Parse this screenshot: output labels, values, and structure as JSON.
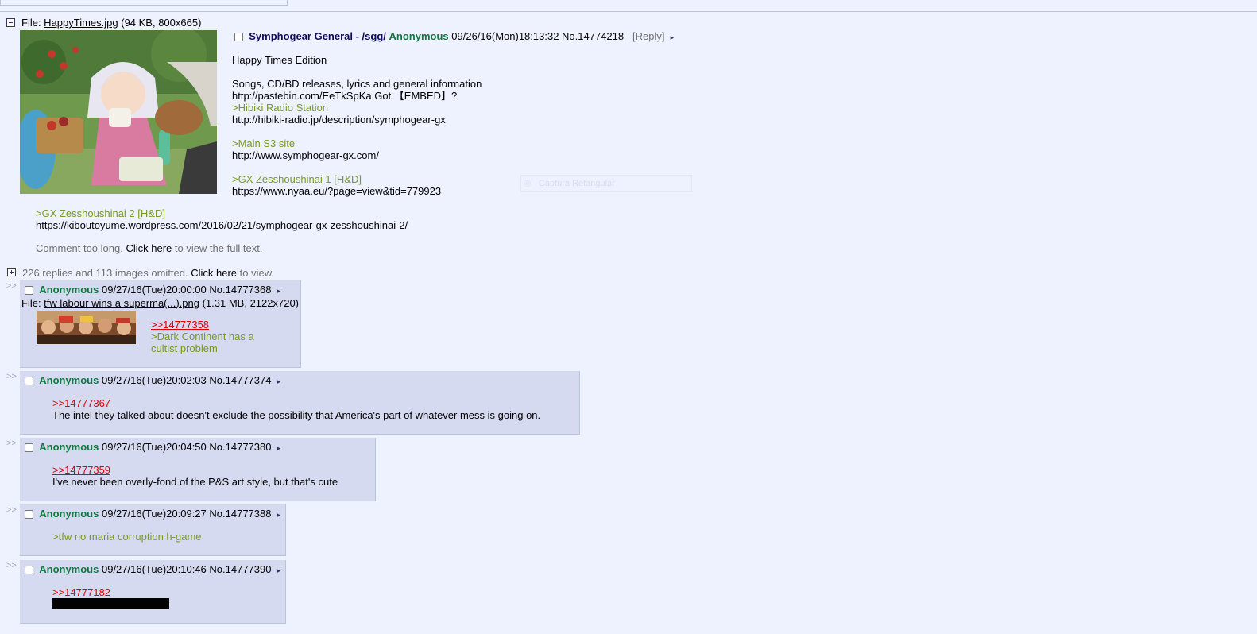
{
  "op": {
    "file_prefix": "File: ",
    "file_name": "HappyTimes.jpg",
    "file_meta": " (94 KB, 800x665)",
    "subject": "Symphogear General - /sgg/",
    "name": "Anonymous",
    "datetime": "09/26/16(Mon)18:13:32",
    "post_no": "No.14774218",
    "reply_link": "[Reply]",
    "arrow": "▸",
    "body": [
      {
        "text": "Happy Times Edition",
        "kind": "text"
      },
      {
        "text": "",
        "kind": "blank"
      },
      {
        "text": "Songs, CD/BD releases, lyrics and general information",
        "kind": "text"
      },
      {
        "text": "http://pastebin.com/EeTkSpKa Got 【EMBED】?",
        "kind": "text"
      },
      {
        "text": ">Hibiki Radio Station",
        "kind": "quote"
      },
      {
        "text": "http://hibiki-radio.jp/description/symphogear-gx",
        "kind": "text"
      },
      {
        "text": "",
        "kind": "blank"
      },
      {
        "text": ">Main S3 site",
        "kind": "quote"
      },
      {
        "text": "http://www.symphogear-gx.com/",
        "kind": "text"
      },
      {
        "text": "",
        "kind": "blank"
      },
      {
        "text": ">GX Zesshoushinai 1 [H&D]",
        "kind": "quote"
      },
      {
        "text": "https://www.nyaa.eu/?page=view&tid=779923",
        "kind": "text"
      }
    ],
    "body_below": [
      {
        "text": ">GX Zesshoushinai 2 [H&D]",
        "kind": "quote"
      },
      {
        "text": "https://kiboutoyume.wordpress.com/2016/02/21/symphogear-gx-zesshoushinai-2/",
        "kind": "text"
      }
    ],
    "too_long_prefix": "Comment too long. ",
    "too_long_click": "Click here",
    "too_long_suffix": " to view the full text."
  },
  "omitted": {
    "prefix": "226 replies and 113 images omitted. ",
    "click": "Click here",
    "suffix": " to view."
  },
  "overlay_label": "Captura Retangular",
  "side_marker": ">>",
  "replies": [
    {
      "name": "Anonymous",
      "datetime": "09/27/16(Tue)20:00:00",
      "post_no": "No.14777368",
      "file_prefix": "File: ",
      "file_name": "tfw labour wins a superma(...).png",
      "file_meta": " (1.31 MB, 2122x720)",
      "quotelink": ">>14777358",
      "lines": [
        ">Dark Continent has a",
        "cultist problem"
      ]
    },
    {
      "name": "Anonymous",
      "datetime": "09/27/16(Tue)20:02:03",
      "post_no": "No.14777374",
      "quotelink": ">>14777367",
      "text": "The intel they talked about doesn't exclude the possibility that America's part of whatever mess is going on."
    },
    {
      "name": "Anonymous",
      "datetime": "09/27/16(Tue)20:04:50",
      "post_no": "No.14777380",
      "quotelink": ">>14777359",
      "text": "I've never been overly-fond of the P&S art style, but that's cute"
    },
    {
      "name": "Anonymous",
      "datetime": "09/27/16(Tue)20:09:27",
      "post_no": "No.14777388",
      "greentext": ">tfw no maria corruption h-game"
    },
    {
      "name": "Anonymous",
      "datetime": "09/27/16(Tue)20:10:46",
      "post_no": "No.14777390",
      "quotelink": ">>14777182"
    }
  ],
  "colors": {
    "background": "#eef2ff",
    "reply_bg": "#d6daf0",
    "name_green": "#117743",
    "subject_navy": "#0f0c5d",
    "greentext": "#789922",
    "quotelink_red": "#dd0000"
  }
}
